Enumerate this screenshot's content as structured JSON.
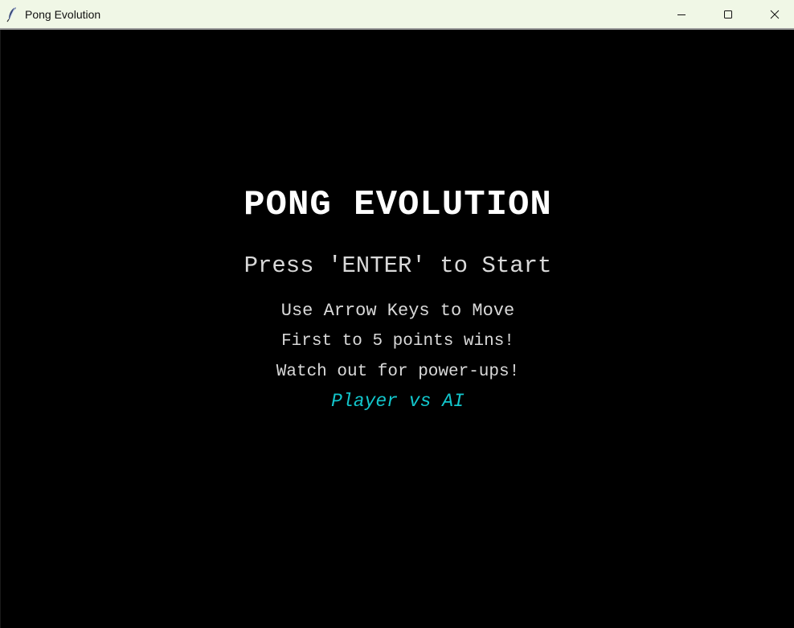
{
  "window": {
    "title": "Pong Evolution",
    "icon": "feather-icon",
    "controls": {
      "minimize": "minimize-icon",
      "maximize": "maximize-icon",
      "close": "close-icon"
    }
  },
  "menu": {
    "title": "PONG EVOLUTION",
    "prompt": "Press 'ENTER' to Start",
    "instructions": [
      "Use Arrow Keys to Move",
      "First to 5 points wins!",
      "Watch out for power-ups!"
    ],
    "mode": "Player vs AI"
  },
  "colors": {
    "background": "#000000",
    "title": "#ffffff",
    "text": "#d9d9d9",
    "mode": "#12c6cc",
    "titlebar": "#f0f7e6"
  }
}
